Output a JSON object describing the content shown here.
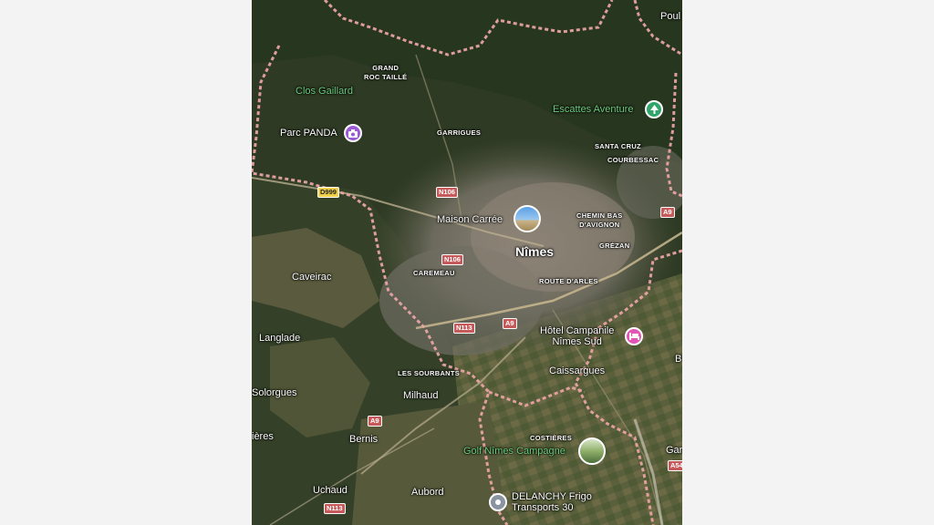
{
  "map": {
    "places": {
      "grand_roc_taille": "GRAND\nROC TAILLÉ",
      "clos_gaillard": "Clos Gaillard",
      "parc_panda": "Parc PANDA",
      "garrigues": "GARRIGUES",
      "escattes_aventure": "Escattes Aventure",
      "santa_cruz": "SANTA CRUZ",
      "courbessac": "COURBESSAC",
      "chemin_bas": "CHEMIN BAS\nD'AVIGNON",
      "maison_carree": "Maison Carrée",
      "nimes": "Nîmes",
      "grezan": "GRÉZAN",
      "caremeau": "CAREMEAU",
      "route_arles": "ROUTE D'ARLES",
      "caveirac": "Caveirac",
      "langlade": "Langlade",
      "hotel_campanile": "Hôtel Campanile\nNîmes Sud",
      "caissargues": "Caissargues",
      "les_sourbants": "LES SOURBANTS",
      "milhaud": "Milhaud",
      "solorgues": "Solorgues",
      "costieres": "COSTIÈRES",
      "golf": "Golf Nîmes Campagne",
      "ieres": "ières",
      "bernis": "Bernis",
      "uchaud": "Uchaud",
      "aubord": "Aubord",
      "delanchy": "DELANCHY Frigo\nTransports 30",
      "poul": "Poul",
      "b_edge": "B",
      "gar_edge": "Gar"
    },
    "roads": {
      "d999": "D999",
      "n106_a": "N106",
      "n106_b": "N106",
      "a9_a": "A9",
      "a9_b": "A9",
      "a9_c": "A9",
      "n113_a": "N113",
      "n113_b": "N113",
      "a54": "A54"
    },
    "colors": {
      "boundary": "#e8a3a3",
      "green_label": "#6fcf7f",
      "attraction_pin": "#9b59d6",
      "park_pin": "#2fa56a",
      "hotel_pin": "#e254b5",
      "business_pin": "#8a93a0",
      "road_shield": "#c65a5a",
      "dept_shield": "#f1d24a"
    },
    "icons": {
      "parc_panda": "camera-icon",
      "escattes": "tree-icon",
      "hotel": "bed-icon",
      "delanchy": "location-dot-icon"
    }
  }
}
